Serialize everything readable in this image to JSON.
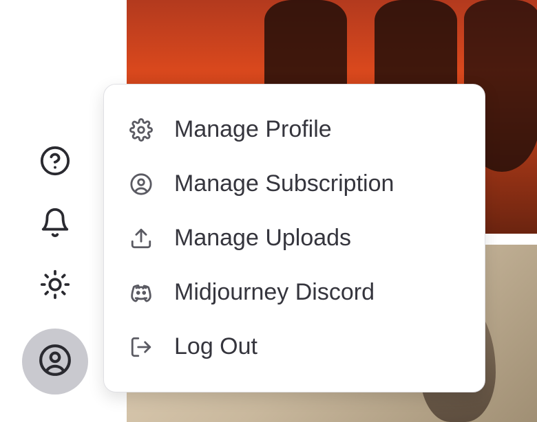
{
  "sidebar": {
    "help": "Help",
    "notifications": "Notifications",
    "theme": "Light mode",
    "account": "Account"
  },
  "menu": {
    "items": [
      {
        "label": "Manage Profile",
        "icon": "gear"
      },
      {
        "label": "Manage Subscription",
        "icon": "user-circle"
      },
      {
        "label": "Manage Uploads",
        "icon": "upload"
      },
      {
        "label": "Midjourney Discord",
        "icon": "discord"
      },
      {
        "label": "Log Out",
        "icon": "logout"
      }
    ]
  }
}
